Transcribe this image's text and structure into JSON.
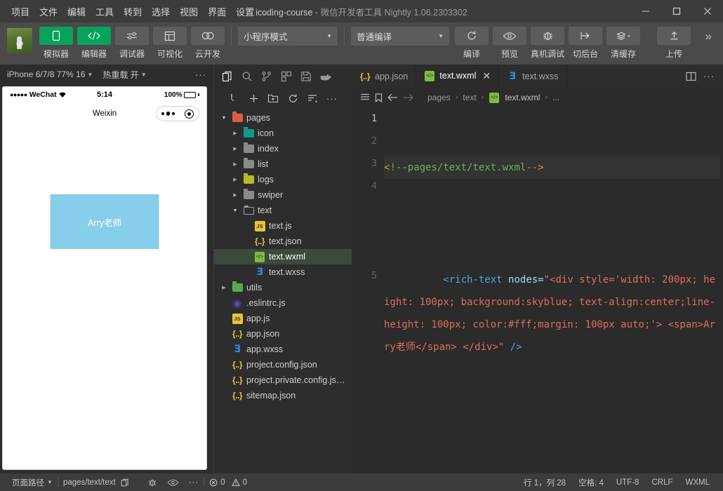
{
  "titlebar": {
    "menus": [
      "项目",
      "文件",
      "编辑",
      "工具",
      "转到",
      "选择",
      "视图",
      "界面",
      "设置",
      "..."
    ],
    "project_name": "icoding-course",
    "title_sep": "-",
    "app_name": "微信开发者工具",
    "version": "Nightly 1.06.2303302",
    "minimize": "—",
    "maximize": "▢",
    "close": "✕"
  },
  "toolbar": {
    "left_buttons": [
      {
        "label": "模拟器",
        "icon": "phone-icon",
        "active": true
      },
      {
        "label": "编辑器",
        "icon": "code-icon",
        "active": true
      },
      {
        "label": "调试器",
        "icon": "sliders-icon",
        "active": false
      },
      {
        "label": "可视化",
        "icon": "layout-icon",
        "active": false
      },
      {
        "label": "云开发",
        "icon": "cloud-icon",
        "active": false
      }
    ],
    "mode_select": "小程序模式",
    "compile_select": "普通编译",
    "right_buttons": [
      {
        "label": "编译",
        "icon": "refresh-icon"
      },
      {
        "label": "预览",
        "icon": "eye-icon"
      },
      {
        "label": "真机调试",
        "icon": "bug-icon"
      },
      {
        "label": "切后台",
        "icon": "background-icon"
      },
      {
        "label": "清缓存",
        "icon": "layers-icon"
      },
      {
        "label": "上传",
        "icon": "upload-icon"
      }
    ],
    "expand": "»"
  },
  "simulator": {
    "device": "iPhone 6/7/8 77% 16",
    "hotreload": "热重载 开",
    "more": "···",
    "phone": {
      "carrier": "WeChat",
      "signal_dots": "●●●●●",
      "wifi_icon": "wifi-icon",
      "time": "5:14",
      "battery_pct": "100%",
      "nav_title": "Weixin",
      "capsule_more": "more-dots-icon",
      "capsule_target": "target-icon",
      "content_text": "Arry老师",
      "content_bg": "skyblue",
      "content_color": "#ffffff"
    }
  },
  "explorer": {
    "activity_icons": [
      "files-icon",
      "search-icon",
      "source-control-icon",
      "extensions-icon",
      "save-icon",
      "cloud-docker-icon"
    ],
    "tool_icons": [
      "collapse-icon",
      "new-file-icon",
      "new-folder-icon",
      "refresh-icon",
      "sort-icon",
      "more-icon"
    ],
    "tree": [
      {
        "label": "pages",
        "indent": 0,
        "arrow": "open",
        "icon": "folder-red"
      },
      {
        "label": "icon",
        "indent": 1,
        "arrow": "closed",
        "icon": "folder-teal"
      },
      {
        "label": "index",
        "indent": 1,
        "arrow": "closed",
        "icon": "folder-grey"
      },
      {
        "label": "list",
        "indent": 1,
        "arrow": "closed",
        "icon": "folder-grey"
      },
      {
        "label": "logs",
        "indent": 1,
        "arrow": "closed",
        "icon": "folder-olive"
      },
      {
        "label": "swiper",
        "indent": 1,
        "arrow": "closed",
        "icon": "folder-grey"
      },
      {
        "label": "text",
        "indent": 1,
        "arrow": "open",
        "icon": "folder-open"
      },
      {
        "label": "text.js",
        "indent": 2,
        "arrow": "none",
        "icon": "js"
      },
      {
        "label": "text.json",
        "indent": 2,
        "arrow": "none",
        "icon": "json"
      },
      {
        "label": "text.wxml",
        "indent": 2,
        "arrow": "none",
        "icon": "wxml",
        "selected": true
      },
      {
        "label": "text.wxss",
        "indent": 2,
        "arrow": "none",
        "icon": "wxss"
      },
      {
        "label": "utils",
        "indent": 0,
        "arrow": "closed",
        "icon": "folder-green"
      },
      {
        "label": ".eslintrc.js",
        "indent": 0,
        "arrow": "none",
        "icon": "eslint"
      },
      {
        "label": "app.js",
        "indent": 0,
        "arrow": "none",
        "icon": "js"
      },
      {
        "label": "app.json",
        "indent": 0,
        "arrow": "none",
        "icon": "json"
      },
      {
        "label": "app.wxss",
        "indent": 0,
        "arrow": "none",
        "icon": "wxss"
      },
      {
        "label": "project.config.json",
        "indent": 0,
        "arrow": "none",
        "icon": "json"
      },
      {
        "label": "project.private.config.js…",
        "indent": 0,
        "arrow": "none",
        "icon": "json"
      },
      {
        "label": "sitemap.json",
        "indent": 0,
        "arrow": "none",
        "icon": "json"
      }
    ]
  },
  "editor": {
    "tabs": [
      {
        "label": "app.json",
        "icon": "json",
        "active": false,
        "closable": false
      },
      {
        "label": "text.wxml",
        "icon": "wxml",
        "active": true,
        "closable": true,
        "close": "✕"
      },
      {
        "label": "text.wxss",
        "icon": "wxss",
        "active": false,
        "closable": false
      }
    ],
    "tab_actions": [
      "split-editor-icon",
      "more-icon"
    ],
    "breadcrumb": {
      "icons": [
        "outline-icon",
        "bookmark-icon",
        "back-arrow-icon",
        "forward-arrow-icon"
      ],
      "parts": [
        "pages",
        "text",
        "text.wxml",
        "..."
      ],
      "separator": "›"
    },
    "line_numbers": [
      "1",
      "2",
      "3",
      "4",
      "5"
    ],
    "code": {
      "line1_comment": "<!--pages/text/text.wxml-->",
      "line3_tag_open": "<rich-text",
      "line3_attr": "nodes=",
      "line3_value": "\"<div style='width: 200px; height: 100px; background:skyblue; text-align:center;line-height: 100px; color:#fff;margin: 100px auto;'> <span>Arry老师</span> </div>\"",
      "line3_selfclose": "/>"
    }
  },
  "statusbar": {
    "page_path_label": "页面路径",
    "page_path_value": "pages/text/text",
    "copy_icon": "copy-icon",
    "icons": [
      "bug-icon",
      "eye-icon",
      "more-icon"
    ],
    "errors": "0",
    "warnings": "0",
    "cursor": "行 1，列 28",
    "spaces": "空格: 4",
    "encoding": "UTF-8",
    "eol": "CRLF",
    "language": "WXML"
  }
}
